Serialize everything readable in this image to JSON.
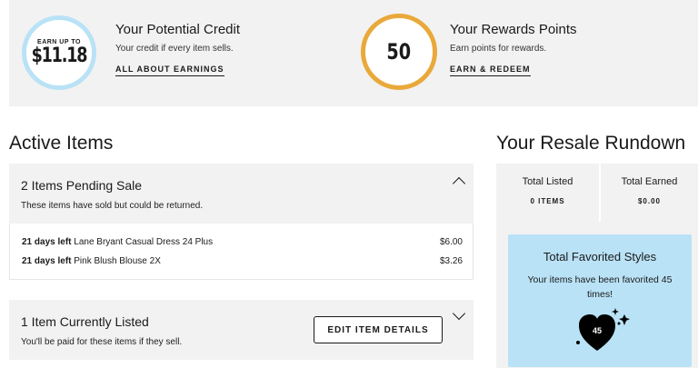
{
  "credit": {
    "circle_small": "EARN UP TO",
    "circle_amount": "$11.18",
    "title": "Your Potential Credit",
    "subtitle": "Your credit if every item sells.",
    "link": "ALL ABOUT EARNINGS"
  },
  "rewards": {
    "points": "50",
    "title": "Your Rewards Points",
    "subtitle": "Earn points for rewards.",
    "link": "EARN & REDEEM"
  },
  "active": {
    "heading": "Active Items",
    "pending": {
      "title": "2 Items Pending Sale",
      "subtitle": "These items have sold but could be returned.",
      "items": [
        {
          "days": "21 days left",
          "name": "Lane Bryant Casual Dress 24 Plus",
          "price": "$6.00"
        },
        {
          "days": "21 days left",
          "name": "Pink Blush Blouse 2X",
          "price": "$3.26"
        }
      ]
    },
    "listed": {
      "title": "1 Item Currently Listed",
      "subtitle": "You'll be paid for these items if they sell.",
      "button": "EDIT ITEM DETAILS"
    }
  },
  "rundown": {
    "heading": "Your Resale Rundown",
    "total_listed_label": "Total Listed",
    "total_listed_value": "0 ITEMS",
    "total_earned_label": "Total Earned",
    "total_earned_value": "$0.00",
    "favorites": {
      "title": "Total Favorited Styles",
      "text": "Your items have been favorited 45 times!",
      "count": "45"
    }
  },
  "colors": {
    "credit_ring": "#b9e2f6",
    "points_ring": "#e9a93a",
    "favorites_bg": "#b9e2f6",
    "panel_bg": "#f2f2f2"
  }
}
